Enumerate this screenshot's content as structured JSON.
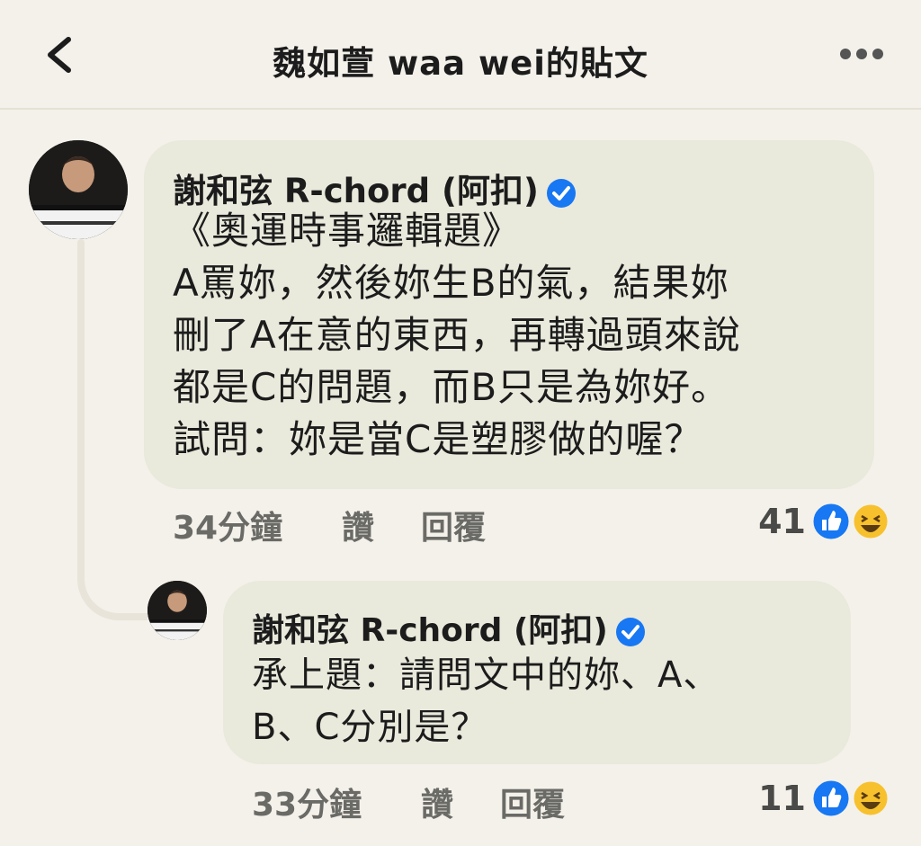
{
  "header": {
    "title": "魏如萱 waa wei的貼文",
    "back_icon": "chevron-left-icon",
    "more_icon": "more-horizontal-icon"
  },
  "comments": [
    {
      "author": "謝和弦 R-chord (阿扣)",
      "verified": true,
      "lines": [
        "《奧運時事邏輯題》",
        "A罵妳，然後妳生B的氣，結果妳",
        "刪了A在意的東西，再轉過頭來說",
        "都是C的問題，而B只是為妳好。",
        "試問：妳是當C是塑膠做的喔？"
      ],
      "time": "34分鐘",
      "like_label": "讚",
      "reply_label": "回覆",
      "reaction_count": "41",
      "reactions": [
        "like-icon",
        "haha-icon"
      ]
    },
    {
      "author": "謝和弦 R-chord (阿扣)",
      "verified": true,
      "lines": [
        "承上題：請問文中的妳、A、",
        "B、C分別是？"
      ],
      "time": "33分鐘",
      "like_label": "讚",
      "reply_label": "回覆",
      "reaction_count": "11",
      "reactions": [
        "like-icon",
        "haha-icon"
      ]
    }
  ],
  "colors": {
    "background": "#f4f1ea",
    "bubble": "#e9e9dc",
    "verified_blue": "#1877f2",
    "like_blue": "#1877f2",
    "haha_yellow": "#f7c12e"
  }
}
